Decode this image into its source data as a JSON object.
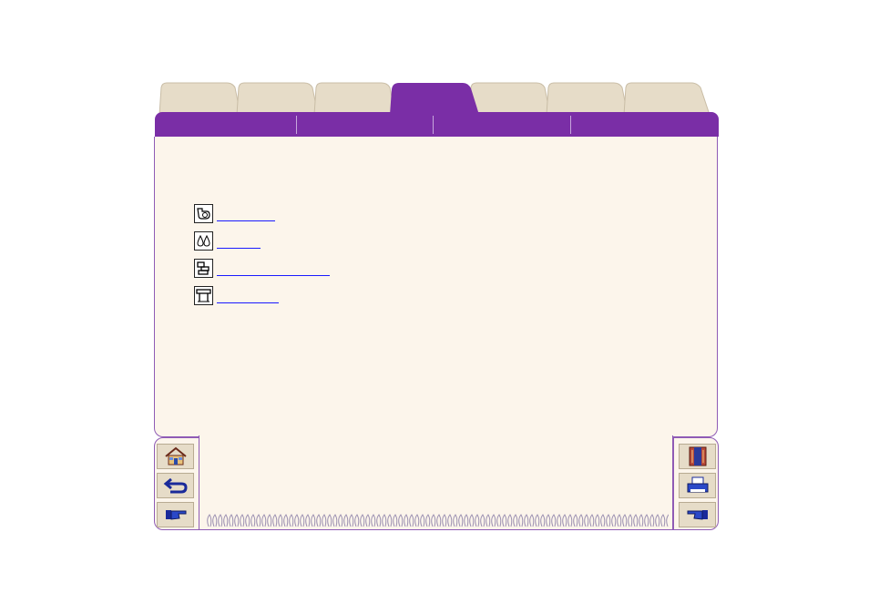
{
  "tabs": [
    {
      "label": ""
    },
    {
      "label": ""
    },
    {
      "label": ""
    },
    {
      "label": "",
      "active": true
    },
    {
      "label": ""
    },
    {
      "label": ""
    },
    {
      "label": ""
    }
  ],
  "subnav": [
    {
      "label": ""
    },
    {
      "label": ""
    },
    {
      "label": ""
    },
    {
      "label": ""
    }
  ],
  "links": [
    {
      "label": "",
      "icon": "drum-icon"
    },
    {
      "label": "",
      "icon": "ink-drops-icon"
    },
    {
      "label": "",
      "icon": "components-icon"
    },
    {
      "label": "",
      "icon": "printer-stand-icon"
    }
  ],
  "nav_left": [
    "home-icon",
    "back-arrow-icon",
    "next-hand-icon"
  ],
  "nav_right": [
    "contents-book-icon",
    "print-icon",
    "previous-hand-icon"
  ],
  "colors": {
    "band": "#7a2ea6",
    "card": "#fcf5eb",
    "tab": "#e6dcc8",
    "link": "#1a1aff"
  }
}
